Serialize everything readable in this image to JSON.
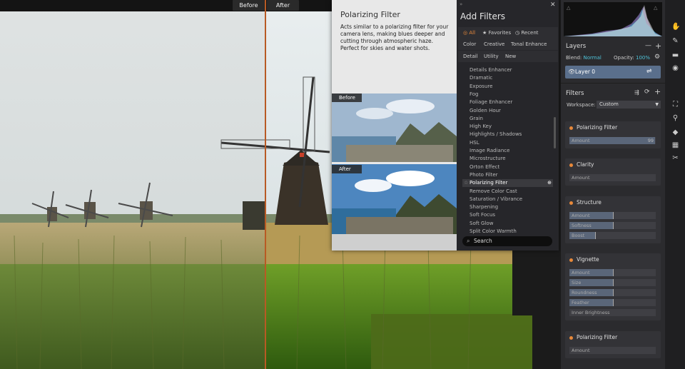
{
  "compare": {
    "before_label": "Before",
    "after_label": "After"
  },
  "preview": {
    "title": "Polarizing Filter",
    "description": "Acts similar to a polarizing filter for your camera lens, making blues deeper and cutting through atmospheric haze. Perfect for skies and water shots.",
    "before_label": "Before",
    "after_label": "After"
  },
  "add_filters": {
    "title": "Add Filters",
    "tabs_row1": [
      "All",
      "Favorites",
      "Recent"
    ],
    "tabs_row2": [
      "Color",
      "Creative",
      "Tonal Enhance"
    ],
    "tabs_row3": [
      "Detail",
      "Utility",
      "New"
    ],
    "items": [
      "Details Enhancer",
      "Dramatic",
      "Exposure",
      "Fog",
      "Foliage Enhancer",
      "Golden Hour",
      "Grain",
      "High Key",
      "Highlights / Shadows",
      "HSL",
      "Image Radiance",
      "Microstructure",
      "Orton Effect",
      "Photo Filter",
      "Polarizing Filter",
      "Remove Color Cast",
      "Saturation / Vibrance",
      "Sharpening",
      "Soft Focus",
      "Soft Glow",
      "Split Color Warmth"
    ],
    "selected": "Polarizing Filter",
    "search_placeholder": "Search"
  },
  "layers": {
    "title": "Layers",
    "blend_label": "Blend:",
    "blend_value": "Normal",
    "opacity_label": "Opacity:",
    "opacity_value": "100%",
    "layer_name": "Layer 0"
  },
  "filters": {
    "title": "Filters",
    "workspace_label": "Workspace:",
    "workspace_value": "Custom",
    "cards": [
      {
        "name": "Polarizing Filter",
        "sliders": [
          {
            "label": "Amount",
            "value": "99",
            "level": 0.99
          }
        ]
      },
      {
        "name": "Clarity",
        "sliders": [
          {
            "label": "Amount",
            "value": "",
            "level": 0.0
          }
        ]
      },
      {
        "name": "Structure",
        "sliders": [
          {
            "label": "Amount",
            "value": "",
            "level": 0.5
          },
          {
            "label": "Softness",
            "value": "",
            "level": 0.5
          },
          {
            "label": "Boost",
            "value": "",
            "level": 0.3
          }
        ]
      },
      {
        "name": "Vignette",
        "sliders": [
          {
            "label": "Amount",
            "value": "",
            "level": 0.5
          },
          {
            "label": "Size",
            "value": "",
            "level": 0.5
          },
          {
            "label": "Roundness",
            "value": "",
            "level": 0.5
          },
          {
            "label": "Feather",
            "value": "",
            "level": 0.5
          },
          {
            "label": "Inner Brightness",
            "value": "",
            "level": 0.0
          }
        ]
      },
      {
        "name": "Polarizing Filter",
        "sliders": [
          {
            "label": "Amount",
            "value": "",
            "level": 0.0
          }
        ]
      }
    ]
  },
  "colors": {
    "accent": "#e8893a",
    "split_line": "#b85a24",
    "layer_selected": "#5a6f8c",
    "teal": "#4fc3d9"
  },
  "tools": [
    "hand-icon",
    "brush-icon",
    "gradient-icon",
    "radial-icon",
    "crop-icon",
    "clone-stamp-icon",
    "eraser-icon",
    "pattern-icon",
    "scissors-icon"
  ]
}
